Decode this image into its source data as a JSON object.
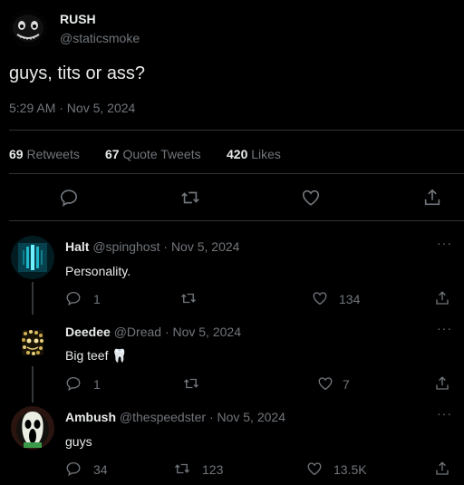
{
  "tweet": {
    "author_name": "RUSH",
    "author_handle": "@staticsmoke",
    "text": "guys, tits or ass?",
    "time": "5:29 AM · Nov 5, 2024",
    "stats": {
      "retweets_count": "69",
      "retweets_label": "Retweets",
      "quotes_count": "67",
      "quotes_label": "Quote Tweets",
      "likes_count": "420",
      "likes_label": "Likes"
    },
    "actions": [
      "reply-icon",
      "retweet-icon",
      "like-icon",
      "share-icon"
    ]
  },
  "replies": [
    {
      "name": "Halt",
      "handle": "@spinghost",
      "date": "· Nov 5, 2024",
      "text": "Personality.",
      "reply_count": "1",
      "retweet_count": "",
      "like_count": "134"
    },
    {
      "name": "Deedee",
      "handle": "@Dread",
      "date": "· Nov 5, 2024",
      "text": "Big teef",
      "emoji": "🦷",
      "reply_count": "1",
      "retweet_count": "",
      "like_count": "7"
    },
    {
      "name": "Ambush",
      "handle": "@thespeedster",
      "date": "· Nov 5, 2024",
      "text": "guys",
      "reply_count": "34",
      "retweet_count": "123",
      "like_count": "13.5K"
    }
  ],
  "more_label": "···",
  "colors": {
    "background": "#000000",
    "text": "#e7e9ea",
    "muted": "#71767b",
    "divider": "#2f3336"
  }
}
